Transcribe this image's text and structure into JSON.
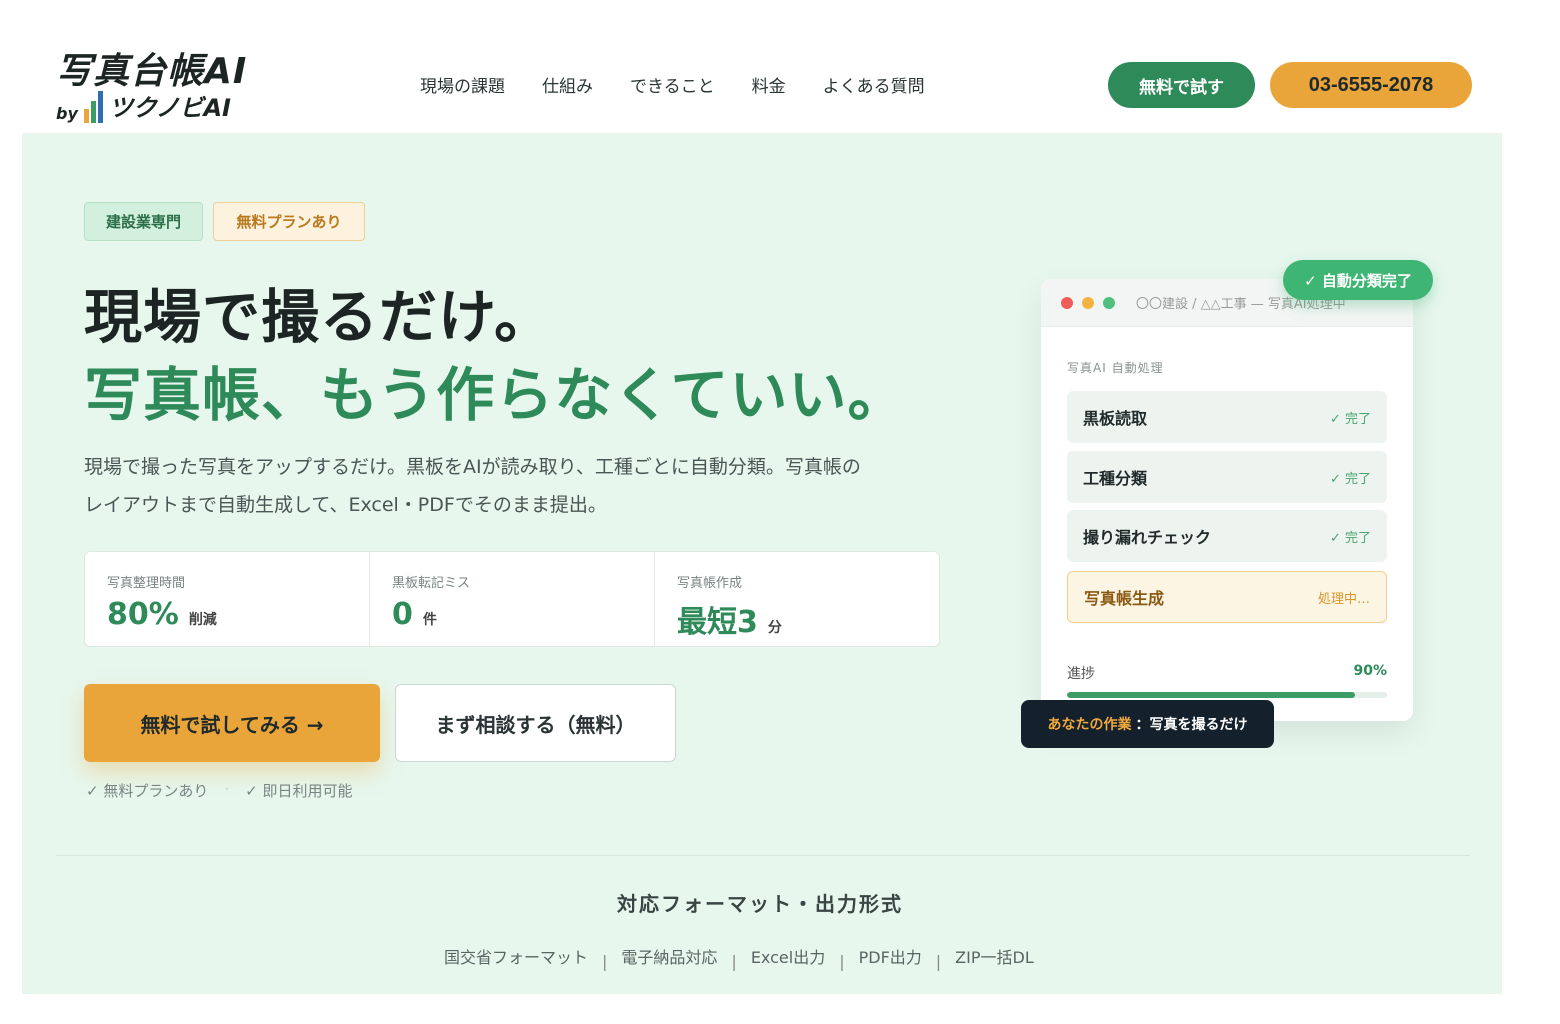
{
  "brand": {
    "title": "写真台帳AI",
    "by": "by",
    "company": "ツクノビAI",
    "bar_colors": [
      "#e9a53a",
      "#3d9b66",
      "#2f6fb0"
    ]
  },
  "nav": {
    "items": [
      "現場の課題",
      "仕組み",
      "できること",
      "料金",
      "よくある質問"
    ],
    "try_button": "無料で試す",
    "phone": "03-6555-2078"
  },
  "hero": {
    "tags": [
      "建設業専門",
      "無料プランあり"
    ],
    "headline_1": "現場で撮るだけ。",
    "headline_2": "写真帳、もう作らなくていい。",
    "description_1": "現場で撮った写真をアップするだけ。黒板をAIが読み取り、工種ごとに自動分類。写真帳の",
    "description_2": "レイアウトまで自動生成して、Excel・PDFでそのまま提出。"
  },
  "stats": [
    {
      "label": "写真整理時間",
      "value": "80%",
      "unit": "削減"
    },
    {
      "label": "黒板転記ミス",
      "value": "0",
      "unit": "件"
    },
    {
      "label": "写真帳作成",
      "value": "最短3",
      "unit": "分"
    }
  ],
  "cta": {
    "primary": "無料で試してみる →",
    "secondary": "まず相談する（無料）",
    "notes": [
      "✓ 無料プランあり",
      "·",
      "✓ 即日利用可能"
    ]
  },
  "formats": {
    "title": "対応フォーマット・出力形式",
    "items": [
      "国交省フォーマット",
      "電子納品対応",
      "Excel出力",
      "PDF出力",
      "ZIP一括DL"
    ],
    "separator": "|"
  },
  "mock": {
    "path": "〇〇建設 / △△工事 — 写真AI処理中",
    "subtitle": "写真AI 自動処理",
    "steps": [
      {
        "label": "黒板読取",
        "status": "✓ 完了"
      },
      {
        "label": "工種分類",
        "status": "✓ 完了"
      },
      {
        "label": "撮り漏れチェック",
        "status": "✓ 完了"
      },
      {
        "label": "写真帳生成",
        "status": "処理中…"
      }
    ],
    "progress_label": "進捗",
    "progress_value": "90%",
    "progress_fraction": 0.9,
    "dot_colors": [
      "#ef5a5a",
      "#f2b441",
      "#4fc07f"
    ],
    "badge_done": "✓ 自動分類完了",
    "badge_you_highlight": "あなたの作業",
    "badge_you_text": "：写真を撮るだけ"
  }
}
